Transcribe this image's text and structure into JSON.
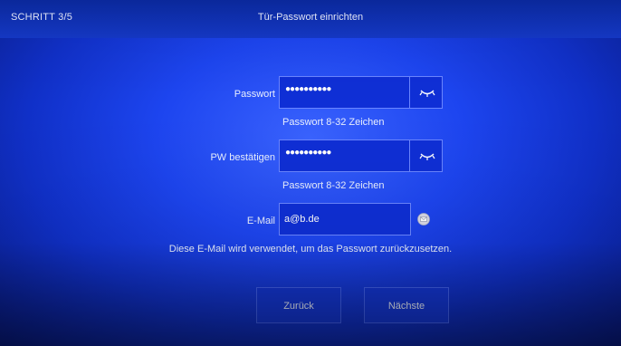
{
  "header": {
    "step": "SCHRITT 3/5",
    "title": "Tür-Passwort einrichten"
  },
  "form": {
    "password": {
      "label": "Passwort",
      "value_masked": "●●●●●●●●●●",
      "hint": "Passwort 8-32 Zeichen",
      "toggle_icon": "eye-closed-icon"
    },
    "confirm": {
      "label": "PW bestätigen",
      "value_masked": "●●●●●●●●●●",
      "hint": "Passwort 8-32 Zeichen",
      "toggle_icon": "eye-closed-icon"
    },
    "email": {
      "label": "E-Mail",
      "value": "a@b.de",
      "icon": "email-icon"
    },
    "info": "Diese E-Mail wird verwendet, um das Passwort zurückzusetzen."
  },
  "actions": {
    "back_label": "Zurück",
    "next_label": "Nächste"
  },
  "colors": {
    "background": "#1d45f0",
    "field": "#0f2fd6",
    "border": "#6b86ff",
    "text": "#eaf0ff"
  }
}
